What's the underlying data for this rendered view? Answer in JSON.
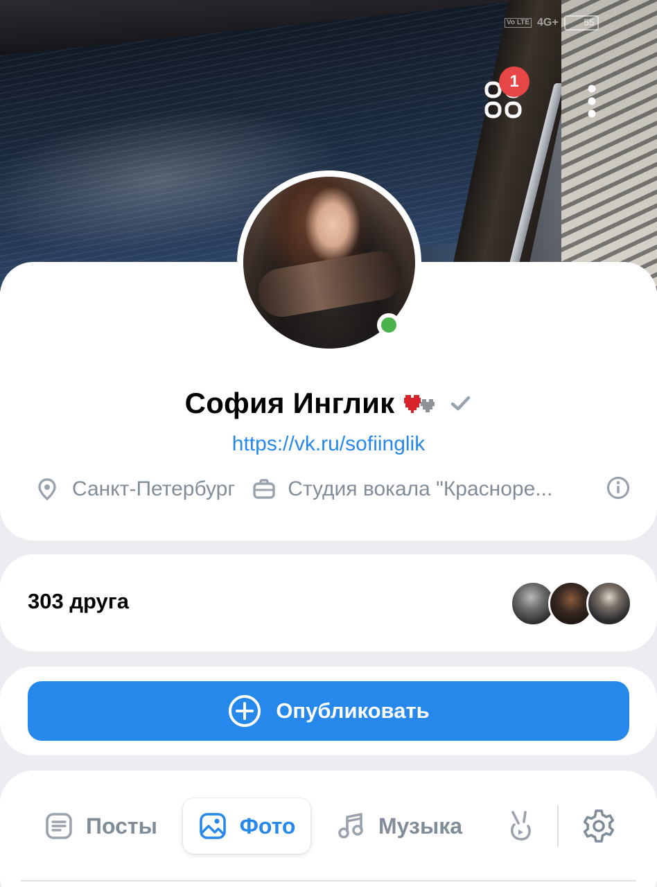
{
  "status_bar": {
    "volte": "Vo LTE",
    "network": "4G+",
    "battery": "55"
  },
  "header": {
    "apps_badge_count": "1",
    "icons": [
      "apps-icon",
      "more-vertical-icon"
    ]
  },
  "profile": {
    "name": "София Инглик",
    "link": "https://vk.ru/sofiinglik",
    "city": "Санкт-Петербург",
    "work": "Студия вокала \"Красноре...",
    "online": true,
    "icons": [
      "pixel-heart-icon",
      "verified-check-icon",
      "location-pin-icon",
      "briefcase-icon",
      "info-circle-icon"
    ]
  },
  "friends": {
    "count_label": "303 друга"
  },
  "publish": {
    "label": "Опубликовать"
  },
  "tabs": {
    "posts": "Посты",
    "photos": "Фото",
    "music": "Музыка",
    "active": "photos"
  },
  "colors": {
    "accent": "#2688eb",
    "secondary_text": "#818c99",
    "background": "#ebedf0",
    "online": "#4bb34b",
    "badge": "#e64646"
  }
}
